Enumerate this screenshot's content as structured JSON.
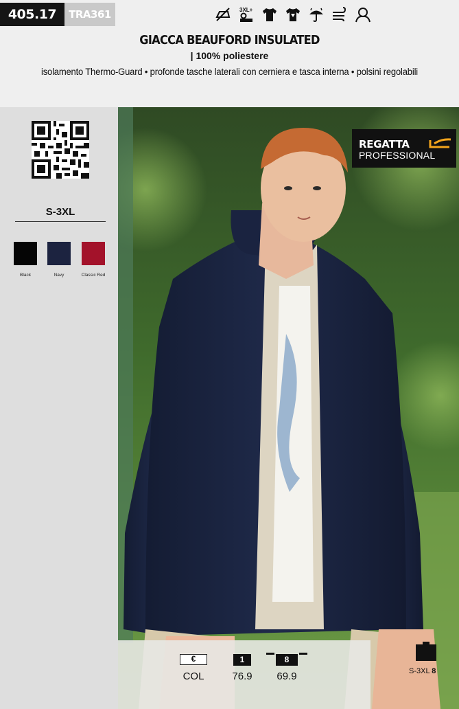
{
  "header": {
    "code": "405.17",
    "ref": "TRA361"
  },
  "icons": [
    "no-ironing-icon",
    "3xl-plus-size-icon",
    "tshirt-icon",
    "tshirt-print-icon",
    "waterproof-umbrella-icon",
    "windproof-icon",
    "hooded-person-icon"
  ],
  "icon_text": {
    "plus_size": "3XL+"
  },
  "product": {
    "title": "GIACCA BEAUFORD INSULATED",
    "material": "| 100% poliestere",
    "features": "isolamento Thermo-Guard • profonde tasche laterali con cerniera e tasca interna • polsini regolabili"
  },
  "sidebar": {
    "size_range": "S-3XL",
    "colors": [
      {
        "name": "Black",
        "hex": "#050505"
      },
      {
        "name": "Navy",
        "hex": "#1c2340"
      },
      {
        "name": "Classic Red",
        "hex": "#a3122a"
      }
    ]
  },
  "brand": {
    "line1": "REGATTA",
    "line2": "PROFESSIONAL",
    "accent": "#f4a51c"
  },
  "pricing": {
    "currency": "€",
    "color_label": "COL",
    "tiers": [
      {
        "qty": "1",
        "price": "76.9"
      },
      {
        "qty": "8",
        "price": "69.9"
      }
    ]
  },
  "pack": {
    "sizes": "S-3XL",
    "count": "8"
  }
}
